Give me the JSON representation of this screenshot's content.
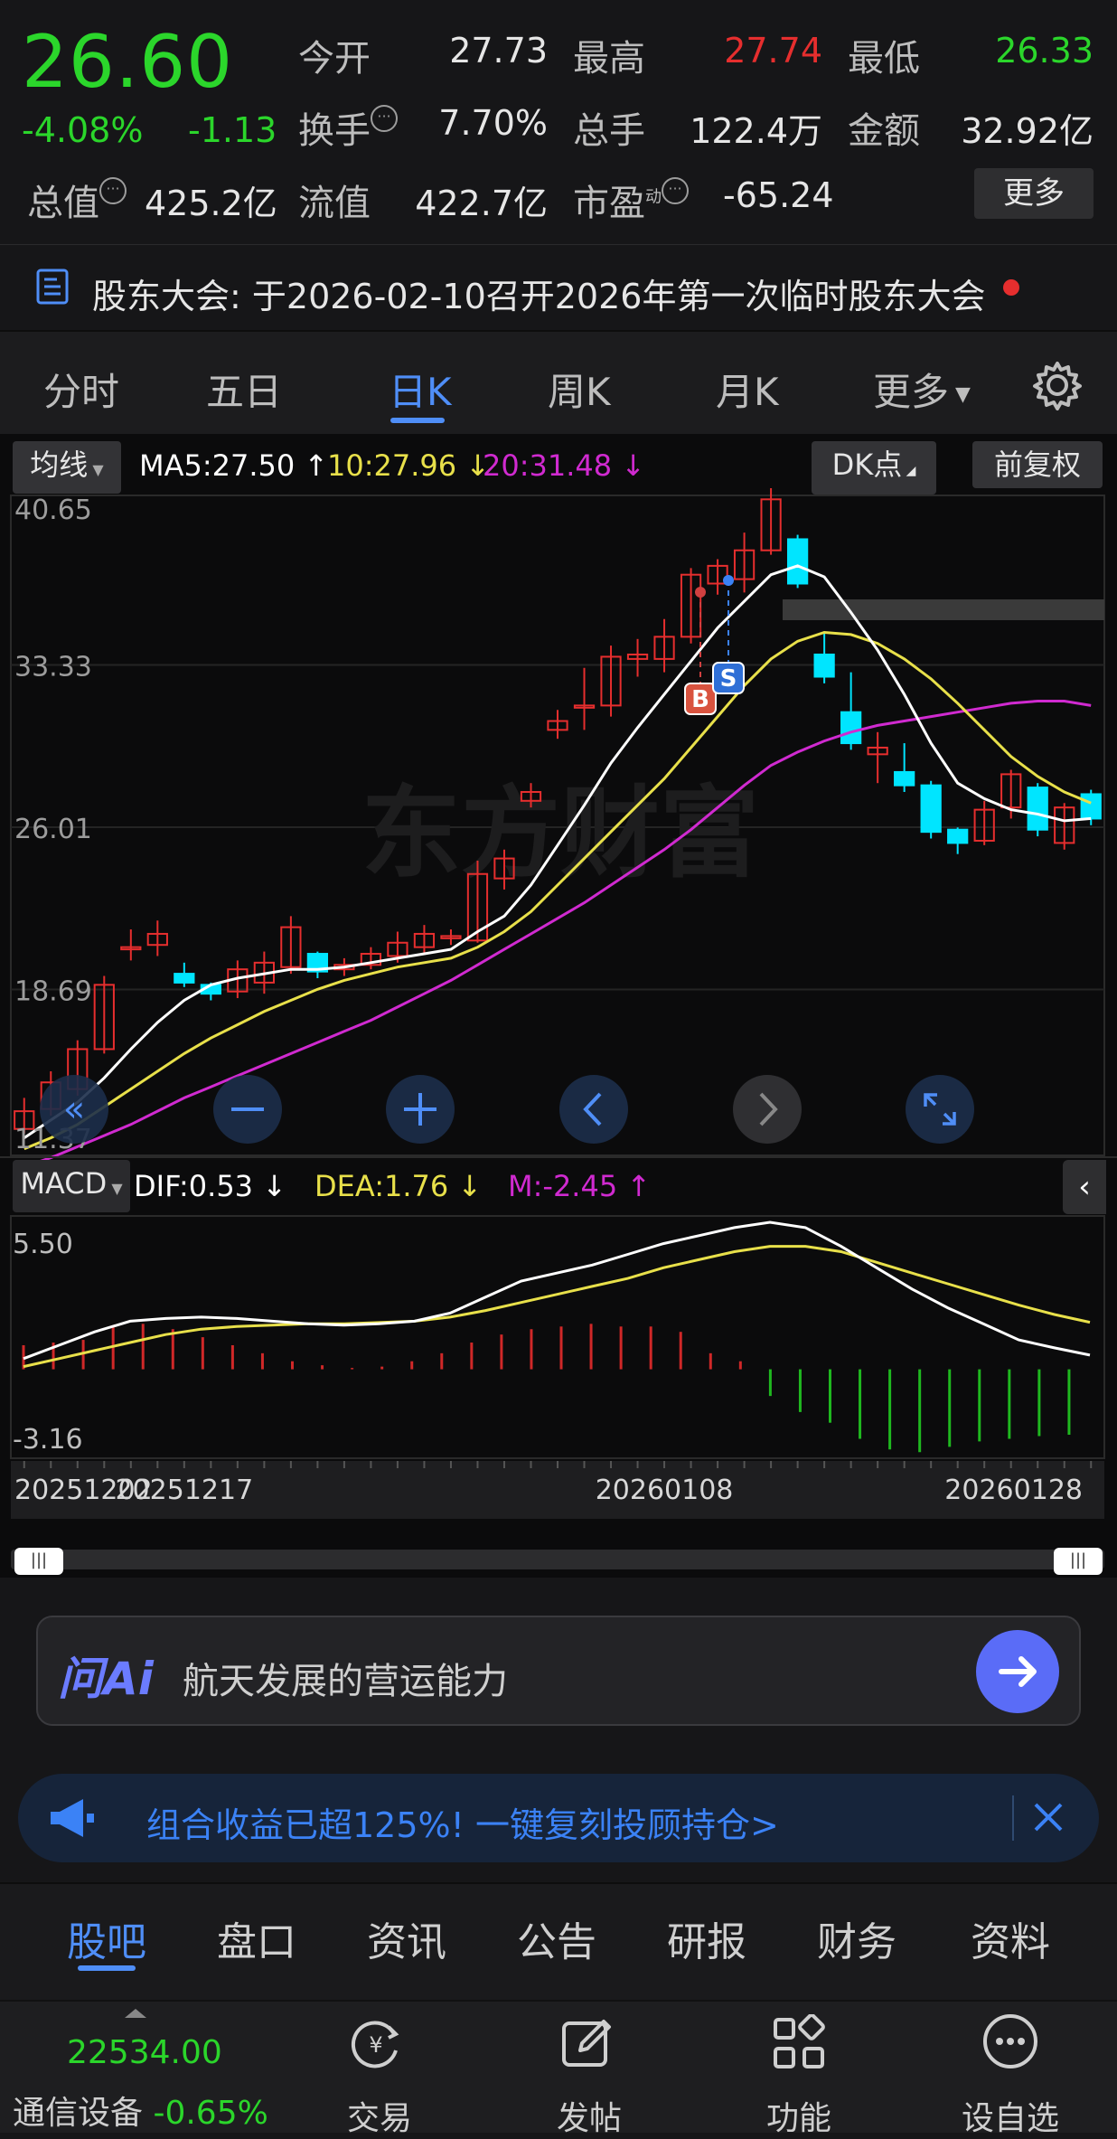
{
  "quote": {
    "price": "26.60",
    "change_pct": "-4.08%",
    "change_amt": "-1.13",
    "open_label": "今开",
    "open_value": "27.73",
    "high_label": "最高",
    "high_value": "27.74",
    "low_label": "最低",
    "low_value": "26.33",
    "turnover_label": "换手",
    "turnover_value": "7.70%",
    "volume_label": "总手",
    "volume_value": "122.4万",
    "amount_label": "金额",
    "amount_value": "32.92亿",
    "mktcap_label": "总值",
    "mktcap_value": "425.2亿",
    "float_label": "流值",
    "float_value": "422.7亿",
    "pe_label": "市盈",
    "pe_sup": "动",
    "pe_value": "-65.24",
    "more_label": "更多"
  },
  "notice": {
    "label": "股东大会:",
    "text": "于2026-02-10召开2026年第一次临时股东大会"
  },
  "period_tabs": [
    "分时",
    "五日",
    "日K",
    "周K",
    "月K",
    "更多"
  ],
  "active_tab": "日K",
  "ma_bar": {
    "dropdown": "均线",
    "ma5": "MA5:27.50",
    "ma10": "10:27.96",
    "ma20": "20:31.48",
    "dk_btn": "DK点",
    "adjust_btn": "前复权"
  },
  "price_axis": [
    "40.65",
    "33.33",
    "26.01",
    "18.69",
    "11.37"
  ],
  "watermark": "东方财富",
  "markers": {
    "buy": "B",
    "sell": "S"
  },
  "macd_bar": {
    "dropdown": "MACD",
    "dif": "DIF:0.53",
    "dea": "DEA:1.76",
    "m": "M:-2.45"
  },
  "macd_axis": [
    "5.50",
    "-3.16"
  ],
  "date_axis": [
    "20251202",
    "20251217",
    "20260108",
    "20260128"
  ],
  "ai": {
    "logo": "问Ai",
    "placeholder": "航天发展的营运能力"
  },
  "promo": {
    "text": "组合收益已超125%! 一键复刻投顾持仓>"
  },
  "sub_tabs": [
    "股吧",
    "盘口",
    "资讯",
    "公告",
    "研报",
    "财务",
    "资料"
  ],
  "index": {
    "value": "22534.00",
    "label": "通信设备",
    "change": "-0.65%"
  },
  "bottom_nav": [
    "交易",
    "发帖",
    "功能",
    "设自选"
  ],
  "colors": {
    "up": "#e62e2e",
    "down": "#00e5ff",
    "green": "#2bd62b",
    "ma5": "#ffffff",
    "ma10": "#e8e04a",
    "ma20": "#d02ad0",
    "accent": "#3b82f6"
  },
  "chart_data": {
    "type": "candlestick",
    "ylim": [
      11.37,
      40.65
    ],
    "x_ticks": [
      "20251202",
      "20251217",
      "20260108",
      "20260128"
    ],
    "candles": [
      {
        "o": 12.4,
        "c": 13.2,
        "h": 13.8,
        "l": 12.2
      },
      {
        "o": 13.3,
        "c": 14.5,
        "h": 15.0,
        "l": 13.0
      },
      {
        "o": 14.2,
        "c": 16.0,
        "h": 16.4,
        "l": 13.9
      },
      {
        "o": 16.0,
        "c": 18.9,
        "h": 19.3,
        "l": 15.8
      },
      {
        "o": 20.5,
        "c": 20.6,
        "h": 21.4,
        "l": 20.0
      },
      {
        "o": 20.7,
        "c": 21.2,
        "h": 21.8,
        "l": 20.2
      },
      {
        "o": 19.4,
        "c": 19.0,
        "h": 19.9,
        "l": 18.8
      },
      {
        "o": 18.9,
        "c": 18.5,
        "h": 19.0,
        "l": 18.2
      },
      {
        "o": 18.6,
        "c": 19.6,
        "h": 20.0,
        "l": 18.3
      },
      {
        "o": 19.0,
        "c": 19.9,
        "h": 20.4,
        "l": 18.5
      },
      {
        "o": 19.7,
        "c": 21.5,
        "h": 22.0,
        "l": 19.4
      },
      {
        "o": 20.3,
        "c": 19.5,
        "h": 20.4,
        "l": 19.2
      },
      {
        "o": 19.6,
        "c": 19.8,
        "h": 20.1,
        "l": 19.3
      },
      {
        "o": 19.8,
        "c": 20.3,
        "h": 20.6,
        "l": 19.6
      },
      {
        "o": 20.2,
        "c": 20.8,
        "h": 21.3,
        "l": 19.9
      },
      {
        "o": 20.6,
        "c": 21.2,
        "h": 21.6,
        "l": 20.3
      },
      {
        "o": 21.0,
        "c": 21.1,
        "h": 21.4,
        "l": 20.7
      },
      {
        "o": 20.9,
        "c": 23.9,
        "h": 24.5,
        "l": 20.8
      },
      {
        "o": 23.7,
        "c": 24.6,
        "h": 25.0,
        "l": 23.2
      },
      {
        "o": 27.2,
        "c": 27.6,
        "h": 28.0,
        "l": 26.9
      },
      {
        "o": 30.4,
        "c": 30.8,
        "h": 31.3,
        "l": 30.0
      },
      {
        "o": 31.4,
        "c": 31.5,
        "h": 33.2,
        "l": 30.4
      },
      {
        "o": 31.5,
        "c": 33.7,
        "h": 34.2,
        "l": 31.0
      },
      {
        "o": 33.6,
        "c": 33.8,
        "h": 34.5,
        "l": 32.8
      },
      {
        "o": 33.6,
        "c": 34.6,
        "h": 35.4,
        "l": 33.0
      },
      {
        "o": 34.6,
        "c": 37.4,
        "h": 37.7,
        "l": 34.3
      },
      {
        "o": 37.0,
        "c": 37.8,
        "h": 38.1,
        "l": 36.5
      },
      {
        "o": 37.2,
        "c": 38.5,
        "h": 39.3,
        "l": 36.6
      },
      {
        "o": 38.5,
        "c": 40.8,
        "h": 41.6,
        "l": 38.3
      },
      {
        "o": 39.0,
        "c": 37.0,
        "h": 39.2,
        "l": 36.8
      },
      {
        "o": 33.8,
        "c": 32.8,
        "h": 34.8,
        "l": 32.5
      },
      {
        "o": 31.2,
        "c": 29.8,
        "h": 33.0,
        "l": 29.5
      },
      {
        "o": 29.3,
        "c": 29.6,
        "h": 30.3,
        "l": 28.0
      },
      {
        "o": 28.5,
        "c": 27.9,
        "h": 29.8,
        "l": 27.6
      },
      {
        "o": 27.9,
        "c": 25.8,
        "h": 28.1,
        "l": 25.5
      },
      {
        "o": 25.9,
        "c": 25.3,
        "h": 26.0,
        "l": 24.8
      },
      {
        "o": 25.4,
        "c": 26.8,
        "h": 27.2,
        "l": 25.2
      },
      {
        "o": 26.9,
        "c": 28.4,
        "h": 28.6,
        "l": 26.4
      },
      {
        "o": 27.8,
        "c": 25.9,
        "h": 28.0,
        "l": 25.6
      },
      {
        "o": 25.3,
        "c": 26.9,
        "h": 27.1,
        "l": 25.0
      },
      {
        "o": 27.5,
        "c": 26.4,
        "h": 27.7,
        "l": 26.1
      }
    ],
    "ma5": [
      12.0,
      12.8,
      13.6,
      14.7,
      16.0,
      17.2,
      18.2,
      18.9,
      19.2,
      19.4,
      19.6,
      19.6,
      19.7,
      19.9,
      20.1,
      20.3,
      20.5,
      21.3,
      22.0,
      23.4,
      25.2,
      27.0,
      28.9,
      30.5,
      32.0,
      33.5,
      35.0,
      36.2,
      37.4,
      37.8,
      37.3,
      35.7,
      34.0,
      32.0,
      29.8,
      28.0,
      27.3,
      26.8,
      26.6,
      26.3,
      26.4
    ],
    "ma10": [
      11.5,
      12.0,
      12.6,
      13.4,
      14.2,
      15.0,
      15.8,
      16.5,
      17.1,
      17.7,
      18.2,
      18.7,
      19.1,
      19.4,
      19.7,
      19.9,
      20.1,
      20.6,
      21.3,
      22.2,
      23.4,
      24.6,
      25.8,
      27.0,
      28.2,
      29.6,
      31.0,
      32.4,
      33.6,
      34.4,
      34.8,
      34.7,
      34.3,
      33.6,
      32.7,
      31.6,
      30.4,
      29.2,
      28.3,
      27.6,
      27.1
    ],
    "ma20": [
      10.7,
      11.1,
      11.6,
      12.1,
      12.6,
      13.2,
      13.8,
      14.3,
      14.8,
      15.3,
      15.8,
      16.3,
      16.8,
      17.3,
      17.9,
      18.5,
      19.1,
      19.8,
      20.5,
      21.2,
      21.9,
      22.6,
      23.4,
      24.2,
      25.0,
      25.9,
      26.9,
      27.9,
      28.8,
      29.4,
      29.9,
      30.3,
      30.6,
      30.8,
      31.0,
      31.2,
      31.4,
      31.6,
      31.7,
      31.7,
      31.5
    ],
    "macd_ylim": [
      -3.16,
      5.5
    ],
    "dif": [
      0.4,
      0.9,
      1.4,
      1.8,
      1.9,
      1.95,
      1.9,
      1.8,
      1.7,
      1.65,
      1.7,
      1.8,
      2.1,
      2.7,
      3.3,
      3.6,
      3.9,
      4.3,
      4.7,
      5.0,
      5.3,
      5.5,
      5.3,
      4.6,
      3.8,
      3.0,
      2.3,
      1.7,
      1.1,
      0.8,
      0.53
    ],
    "dea": [
      0.1,
      0.4,
      0.7,
      1.0,
      1.3,
      1.5,
      1.6,
      1.65,
      1.7,
      1.7,
      1.75,
      1.8,
      1.95,
      2.2,
      2.5,
      2.8,
      3.1,
      3.4,
      3.8,
      4.1,
      4.4,
      4.6,
      4.6,
      4.4,
      4.0,
      3.6,
      3.2,
      2.8,
      2.4,
      2.05,
      1.76
    ],
    "m": [
      0.9,
      1.0,
      1.1,
      1.6,
      1.7,
      1.5,
      1.2,
      0.9,
      0.6,
      0.3,
      0.15,
      0.05,
      0.1,
      0.3,
      0.6,
      1.0,
      1.3,
      1.5,
      1.6,
      1.7,
      1.6,
      1.6,
      1.4,
      0.6,
      0.3,
      -1.0,
      -1.6,
      -2.0,
      -2.6,
      -3.0,
      -3.1,
      -2.9,
      -2.7,
      -2.6,
      -2.5,
      -2.45
    ]
  }
}
